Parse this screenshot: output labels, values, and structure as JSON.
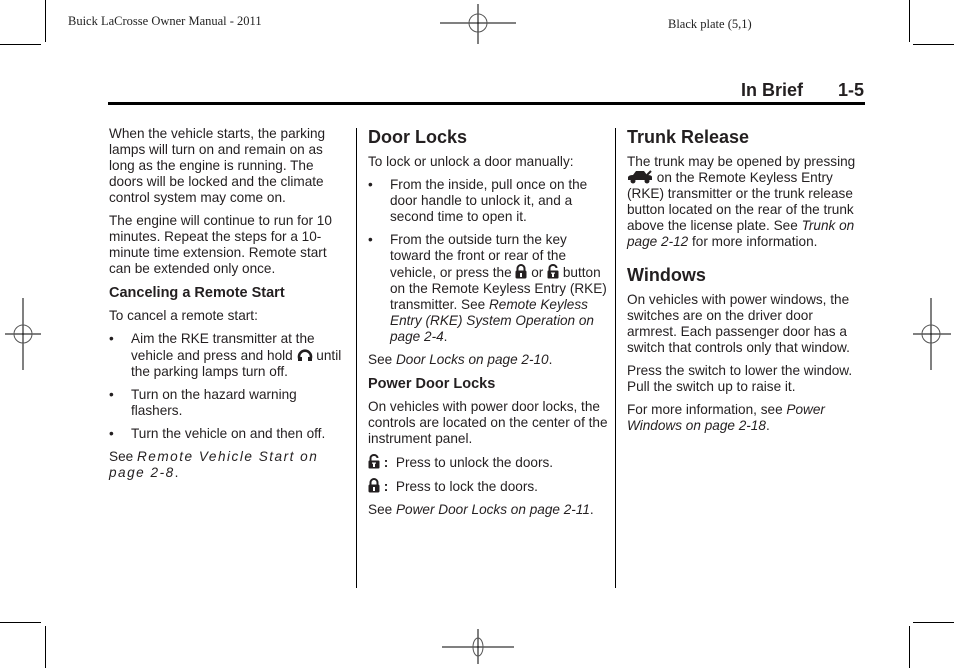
{
  "plate": {
    "left_text": "Buick LaCrosse Owner Manual - 2011",
    "right_text": "Black plate (5,1)"
  },
  "header": {
    "section": "In Brief",
    "page_number": "1-5"
  },
  "column1": {
    "para1": "When the vehicle starts, the parking lamps will turn on and remain on as long as the engine is running. The doors will be locked and the climate control system may come on.",
    "para2": "The engine will continue to run for 10 minutes. Repeat the steps for a 10-minute time extension. Remote start can be extended only once.",
    "subheading": "Canceling a Remote Start",
    "intro": "To cancel a remote start:",
    "bullets": [
      {
        "before": "Aim the RKE transmitter at the vehicle and press and hold",
        "icon": "remote-start-icon",
        "after": "until the parking lamps turn off."
      },
      {
        "text": "Turn on the hazard warning flashers."
      },
      {
        "text": "Turn the vehicle on and then off."
      }
    ],
    "see_prefix": "See ",
    "see_ref": "Remote Vehicle Start on page 2-8",
    "see_suffix": "."
  },
  "column2": {
    "heading": "Door Locks",
    "intro": "To lock or unlock a door manually:",
    "bullets": [
      {
        "text": "From the inside, pull once on the door handle to unlock it, and a second time to open it."
      },
      {
        "before": "From the outside turn the key toward the front or rear of the vehicle, or press the",
        "icon1": "lock-icon",
        "middle": "or",
        "icon2": "unlock-icon",
        "after": "button on the Remote Keyless Entry (RKE) transmitter. See ",
        "ref": "Remote Keyless Entry (RKE) System Operation on page 2-4",
        "ref_suffix": "."
      }
    ],
    "see_prefix": "See ",
    "see_ref": "Door Locks on page 2-10",
    "see_suffix": ".",
    "subheading": "Power Door Locks",
    "power_para": "On vehicles with power door locks, the controls are located on the center of the instrument panel.",
    "unlock_item": {
      "icon": "unlock-icon",
      "separator": ":",
      "text": "Press to unlock the doors."
    },
    "lock_item": {
      "icon": "lock-icon",
      "separator": ":",
      "text": "Press to lock the doors."
    },
    "see2_prefix": "See ",
    "see2_ref": "Power Door Locks on page 2-11",
    "see2_suffix": "."
  },
  "column3": {
    "heading1": "Trunk Release",
    "trunk_before": "The trunk may be opened by pressing",
    "trunk_icon": "trunk-release-icon",
    "trunk_after": "on the Remote Keyless Entry (RKE) transmitter or the trunk release button located on the rear of the trunk above the license plate. See ",
    "trunk_ref": "Trunk on page 2-12",
    "trunk_suffix": " for more information.",
    "heading2": "Windows",
    "win_para1": "On vehicles with power windows, the switches are on the driver door armrest. Each passenger door has a switch that controls only that window.",
    "win_para2": "Press the switch to lower the window. Pull the switch up to raise it.",
    "win_see_prefix": "For more information, see ",
    "win_see_ref": "Power Windows on page 2-18",
    "win_see_suffix": "."
  }
}
